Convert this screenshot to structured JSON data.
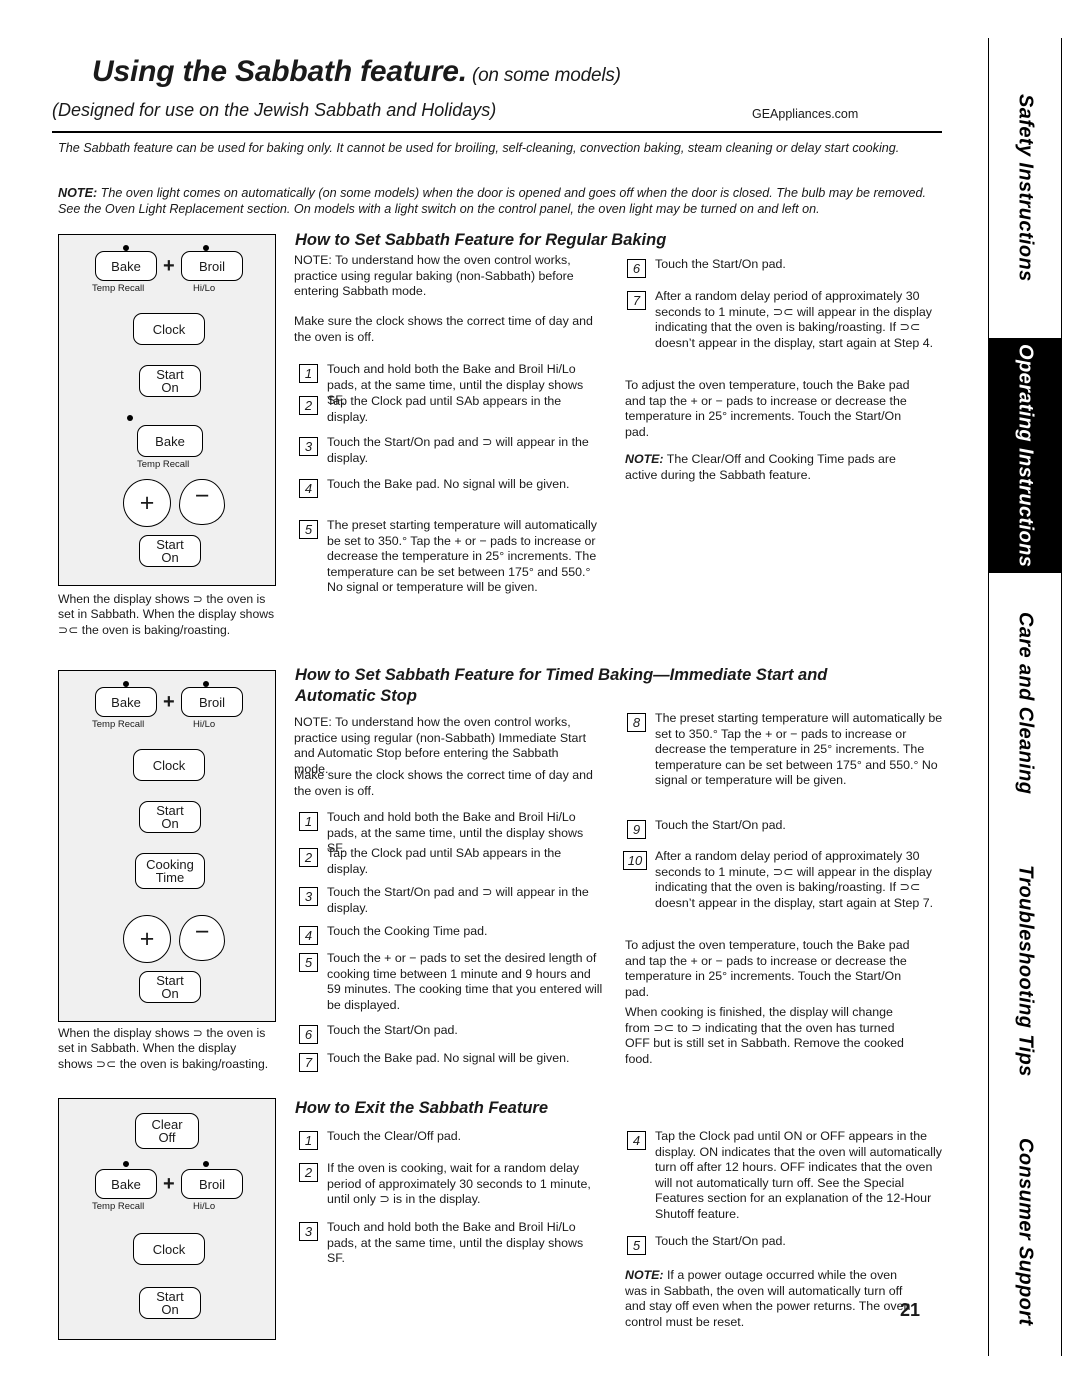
{
  "header": {
    "title_main": "Using the Sabbath feature.",
    "title_small": " (on some models)",
    "subtitle": "(Designed for use on the Jewish Sabbath and Holidays)",
    "website": "GEAppliances.com"
  },
  "intro": {
    "p1": "The Sabbath feature can be used for baking only. It cannot be used for broiling, self-cleaning, convection baking, steam cleaning or delay start cooking.",
    "p2_label": "NOTE:",
    "p2": " The oven light comes on automatically (on some models) when the door is opened and goes off when the door is closed. The bulb may be removed. See the Oven Light Replacement section. On models with a light switch on the control panel, the oven light may be turned on and left on."
  },
  "side_tabs": [
    {
      "label": "Safety Instructions",
      "dark": false
    },
    {
      "label": "Operating Instructions",
      "dark": true
    },
    {
      "label": "Care and Cleaning",
      "dark": false
    },
    {
      "label": "Troubleshooting Tips",
      "dark": false
    },
    {
      "label": "Consumer Support",
      "dark": false
    }
  ],
  "panel1": {
    "pads": [
      "Bake",
      "Broil",
      "Clock",
      "Start",
      "On",
      "Bake",
      "Start",
      "On"
    ],
    "sub_left": "Temp Recall",
    "sub_right": "Hi/Lo",
    "plus": "+",
    "caption": "When the display shows ⊃ the oven is set in Sabbath. When the display shows ⊃⊂ the oven is baking/roasting."
  },
  "panel2": {
    "pads": [
      "Bake",
      "Broil",
      "Clock",
      "Start",
      "On",
      "Cooking",
      "Time",
      "Start",
      "On"
    ],
    "sub_left": "Temp Recall",
    "sub_right": "Hi/Lo",
    "plus": "+",
    "caption": "When the display shows ⊃ the oven is set in Sabbath. When the display shows ⊃⊂ the oven is baking/roasting."
  },
  "panel3": {
    "pads": [
      "Clear",
      "Off",
      "Bake",
      "Broil",
      "Clock",
      "Start",
      "On"
    ],
    "sub_left": "Temp Recall",
    "sub_right": "Hi/Lo",
    "plus": "+"
  },
  "section1": {
    "heading": "How to Set Sabbath Feature for Regular Baking",
    "note": "NOTE: To understand how the oven control works, practice using regular baking (non-Sabbath) before entering Sabbath mode.",
    "note2": "Make sure the clock shows the correct time of day and the oven is off.",
    "steps": [
      {
        "n": "1",
        "text": "Touch and hold both the Bake and Broil Hi/Lo pads, at the same time, until the display shows SF."
      },
      {
        "n": "2",
        "text": "Tap the Clock pad until SAb appears in the display."
      },
      {
        "n": "3",
        "text": "Touch the Start/On pad and ⊃ will appear in the display."
      },
      {
        "n": "4",
        "text": "Touch the Bake pad. No signal will be given."
      },
      {
        "n": "5",
        "text": "The preset starting temperature will automatically be set to 350.° Tap the + or − pads to increase or decrease the temperature in 25° increments. The temperature can be set between 175° and 550.° No signal or temperature will be given."
      },
      {
        "n": "6",
        "text": "Touch the Start/On pad."
      },
      {
        "n": "7",
        "text": "After a random delay period of approximately 30 seconds to 1 minute, ⊃⊂ will appear in the display indicating that the oven is baking/roasting. If ⊃⊂ doesn’t appear in the display, start again at Step 4."
      }
    ],
    "tail1": "To adjust the oven temperature, touch the Bake pad and tap the + or − pads to increase or decrease the temperature in 25° increments. Touch the Start/On pad.",
    "tail2_label": "NOTE:",
    "tail2": " The Clear/Off and Cooking Time pads are active during the Sabbath feature."
  },
  "section2": {
    "heading": "How to Set Sabbath Feature for Timed Baking—Immediate Start and Automatic Stop",
    "note": "NOTE: To understand how the oven control works, practice using regular (non-Sabbath) Immediate Start and Automatic Stop before entering the Sabbath mode.",
    "note2": "Make sure the clock shows the correct time of day and the oven is off.",
    "steps": [
      {
        "n": "1",
        "text": "Touch and hold both the Bake and Broil Hi/Lo pads, at the same time, until the display shows SF."
      },
      {
        "n": "2",
        "text": "Tap the Clock pad until SAb appears in the display."
      },
      {
        "n": "3",
        "text": "Touch the Start/On pad and ⊃ will appear in the display."
      },
      {
        "n": "4",
        "text": "Touch the Cooking Time pad."
      },
      {
        "n": "5",
        "text": "Touch the + or − pads to set the desired length of cooking time between 1 minute and 9 hours and 59 minutes. The cooking time that you entered will be displayed."
      },
      {
        "n": "6",
        "text": "Touch the Start/On pad."
      },
      {
        "n": "7",
        "text": "Touch the Bake pad. No signal will be given."
      },
      {
        "n": "8",
        "text": "The preset starting temperature will automatically be set to 350.° Tap the + or − pads to increase or decrease the temperature in 25° increments. The temperature can be set between 175° and 550.° No signal or temperature will be given."
      },
      {
        "n": "9",
        "text": "Touch the Start/On pad."
      },
      {
        "n": "10",
        "text": "After a random delay period of approximately 30 seconds to 1 minute, ⊃⊂ will appear in the display indicating that the oven is baking/roasting. If ⊃⊂ doesn’t appear in the display, start again at Step 7."
      }
    ],
    "tail1": "To adjust the oven temperature, touch the Bake pad and tap the + or − pads to increase or decrease the temperature in 25° increments. Touch the Start/On pad.",
    "tail2": "When cooking is finished, the display will change from ⊃⊂ to ⊃ indicating that the oven has turned OFF but is still set in Sabbath. Remove the cooked food."
  },
  "section3": {
    "heading": "How to Exit the Sabbath Feature",
    "steps": [
      {
        "n": "1",
        "text": "Touch the Clear/Off pad."
      },
      {
        "n": "2",
        "text": "If the oven is cooking, wait for a random delay period of approximately 30 seconds to 1 minute, until only ⊃ is in the display."
      },
      {
        "n": "3",
        "text": "Touch and hold both the Bake and Broil Hi/Lo pads, at the same time, until the display shows SF."
      },
      {
        "n": "4",
        "text": "Tap the Clock pad until ON or OFF appears in the display. ON indicates that the oven will automatically turn off after 12 hours. OFF indicates that the oven will not automatically turn off. See the Special Features section for an explanation of the 12-Hour Shutoff feature."
      },
      {
        "n": "5",
        "text": "Touch the Start/On pad."
      }
    ],
    "final_note_label": "NOTE:",
    "final_note": " If a power outage occurred while the oven was in Sabbath, the oven will automatically turn off and stay off even when the power returns. The oven control must be reset."
  },
  "page_number": "21"
}
